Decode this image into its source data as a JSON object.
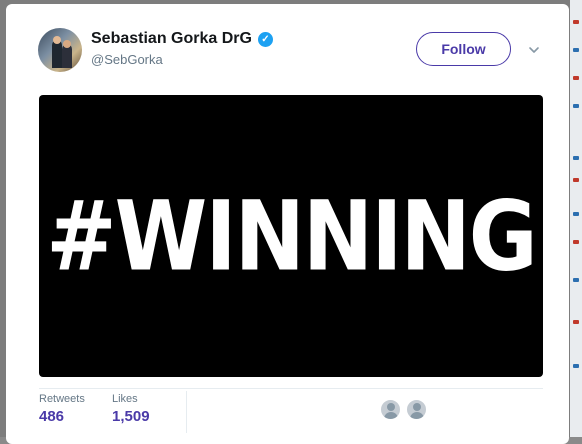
{
  "tweet": {
    "display_name": "Sebastian Gorka DrG",
    "verified_glyph": "✓",
    "handle": "@SebGorka",
    "follow_label": "Follow",
    "media_text": "#WINNING"
  },
  "stats": {
    "retweets_label": "Retweets",
    "retweets_value": "486",
    "likes_label": "Likes",
    "likes_value": "1,509"
  },
  "icons": {
    "verified": "verified-badge-icon",
    "caret": "chevron-down-icon",
    "liker": "user-avatar-icon"
  },
  "colors": {
    "accent": "#4a3aa8",
    "verified": "#1da1f2",
    "handle": "#657786",
    "name": "#14171a",
    "media_bg": "#000000"
  }
}
